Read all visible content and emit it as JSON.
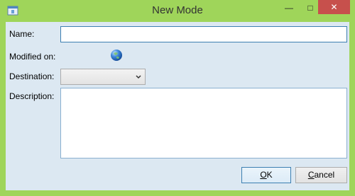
{
  "window": {
    "title": "New Mode",
    "controls": {
      "minimize": "—",
      "maximize": "□",
      "close": "✕"
    }
  },
  "form": {
    "name_label": "Name:",
    "name_value": "",
    "modified_label": "Modified on:",
    "destination_label": "Destination:",
    "destination_value": "",
    "description_label": "Description:",
    "description_value": ""
  },
  "buttons": {
    "ok_label": "OK",
    "cancel_label": "Cancel"
  },
  "colors": {
    "frame": "#9FD55A",
    "client": "#DCE8F2",
    "close": "#C7504C",
    "accent": "#3C7FB1"
  },
  "icons": {
    "app": "app-icon",
    "globe": "globe-icon",
    "dropdown": "chevron-down-icon"
  }
}
